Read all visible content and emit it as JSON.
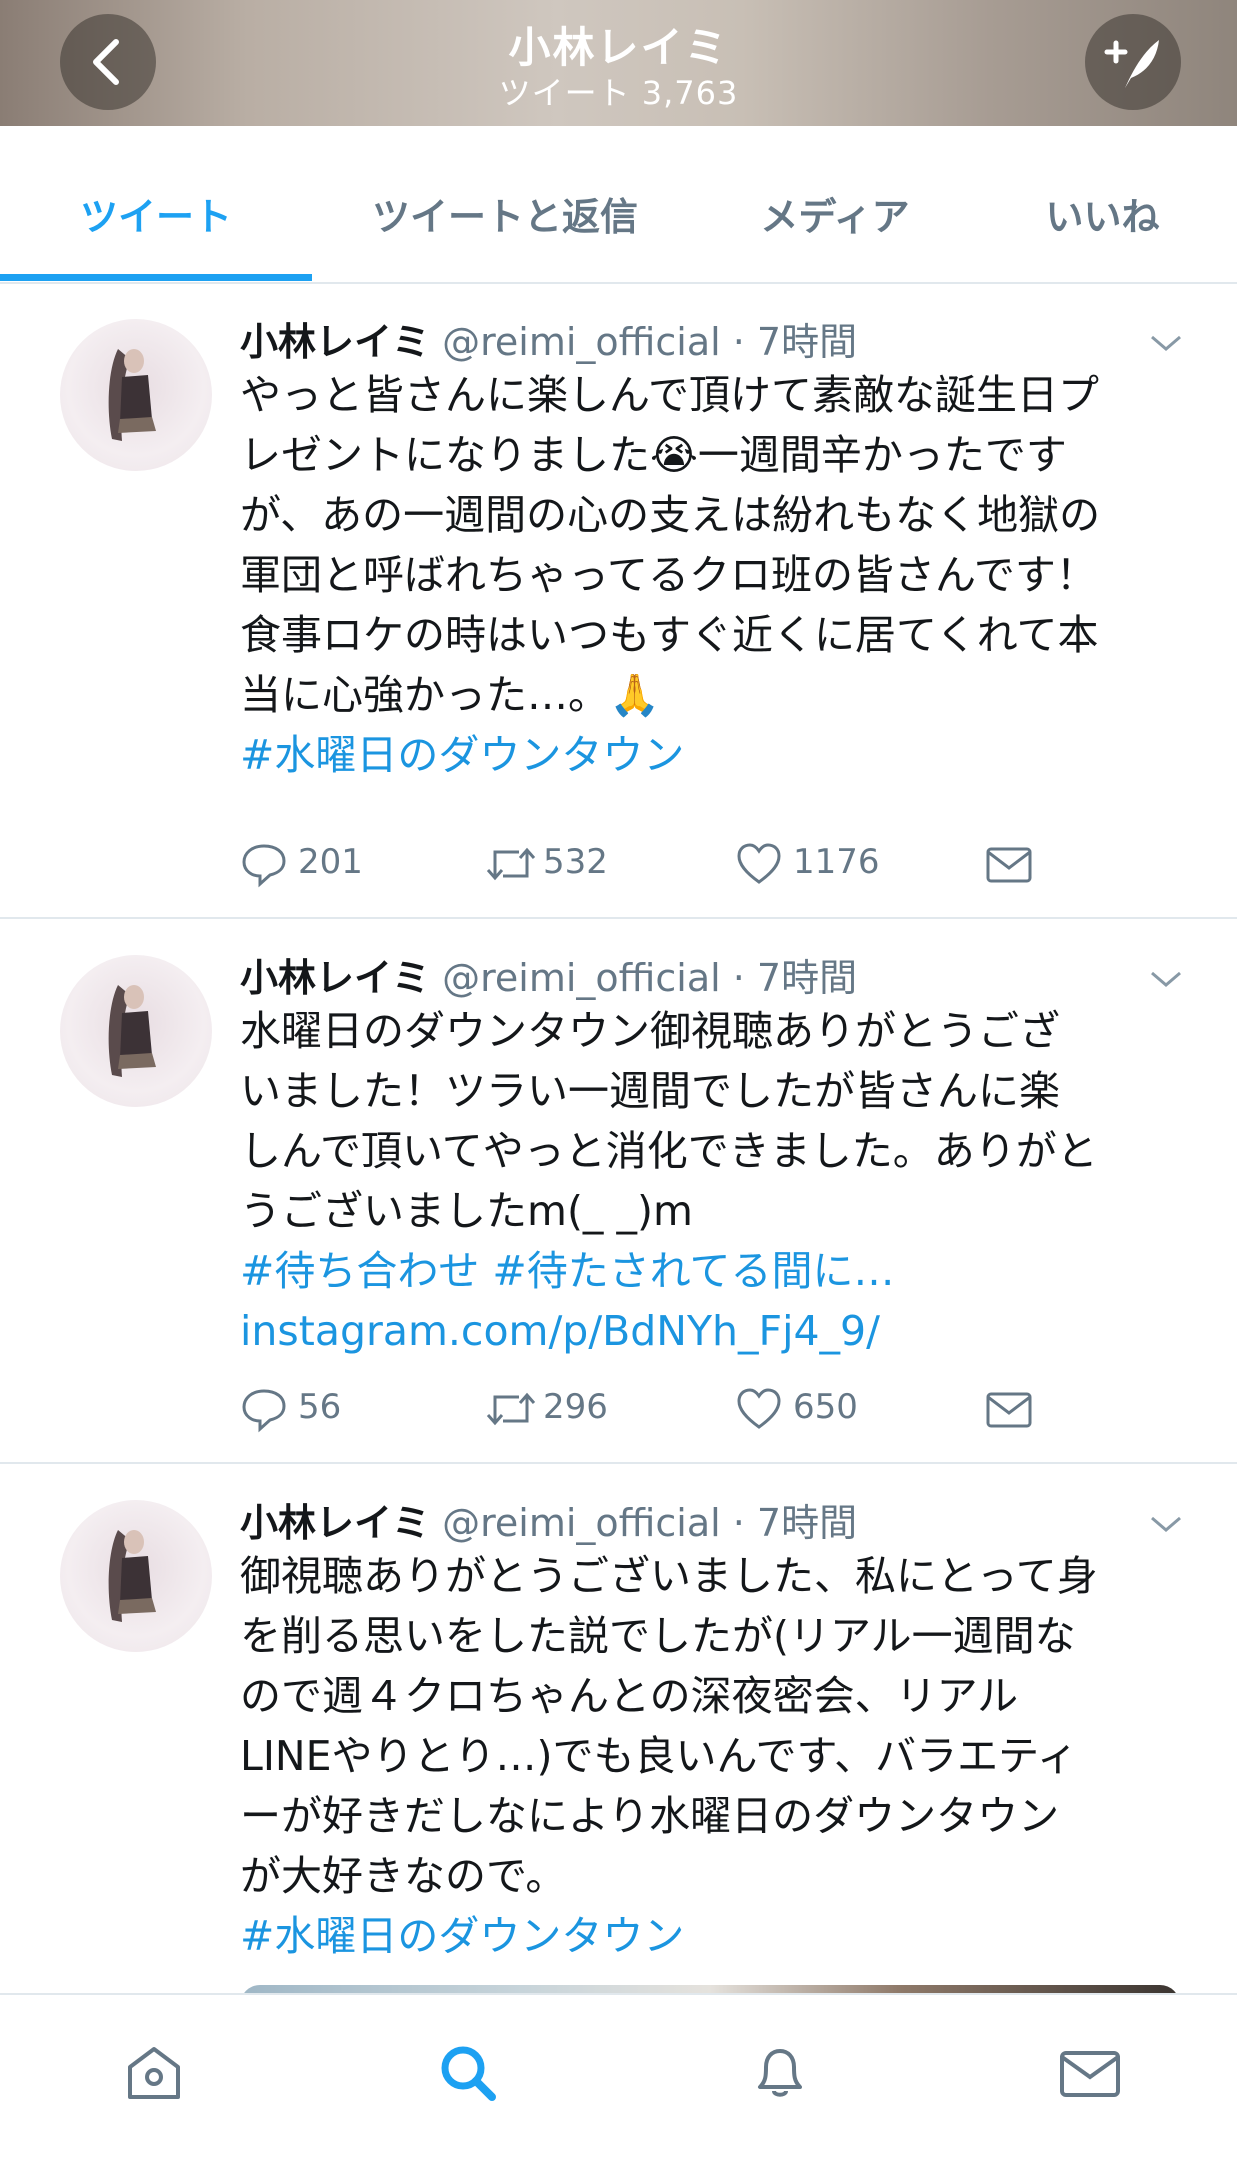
{
  "header": {
    "title": "小林レイミ",
    "tweet_count": "ツイート 3,763",
    "back_icon": "chevron-left-icon",
    "compose_icon": "compose-tweet-icon"
  },
  "tabs": [
    {
      "label": "ツイート",
      "active": true
    },
    {
      "label": "ツイートと返信",
      "active": false
    },
    {
      "label": "メディア",
      "active": false
    },
    {
      "label": "いいね",
      "active": false
    }
  ],
  "tweets": [
    {
      "name": "小林レイミ",
      "handle_time": "@reimi_official · 7時間",
      "lines": [
        "やっと皆さんに楽しんで頂けて素敵な誕生日プ",
        "レゼントになりました😭一週間辛かったです",
        "が、あの一週間の心の支えは紛れもなく地獄の",
        "軍団と呼ばれちゃってるクロ班の皆さんです！",
        "食事ロケの時はいつもすぐ近くに居てくれて本",
        "当に心強かった…。🙏"
      ],
      "links": [
        "#水曜日のダウンタウン"
      ],
      "replies": "201",
      "retweets": "532",
      "likes": "1176"
    },
    {
      "name": "小林レイミ",
      "handle_time": "@reimi_official · 7時間",
      "lines": [
        "水曜日のダウンタウン御視聴ありがとうござ",
        "いました！ツラい一週間でしたが皆さんに楽",
        "しんで頂いてやっと消化できました。ありがと",
        "うございましたm(_ _)m"
      ],
      "links": [
        "#待ち合わせ #待たされてる間に…",
        "instagram.com/p/BdNYh_Fj4_9/"
      ],
      "replies": "56",
      "retweets": "296",
      "likes": "650"
    },
    {
      "name": "小林レイミ",
      "handle_time": "@reimi_official · 7時間",
      "lines": [
        "御視聴ありがとうございました、私にとって身",
        "を削る思いをした説でしたが(リアル一週間な",
        "ので週４クロちゃんとの深夜密会、リアル",
        "LINEやりとり…)でも良いんです、バラエティ",
        "ーが好きだしなにより水曜日のダウンタウン",
        "が大好きなので。"
      ],
      "links": [
        "#水曜日のダウンタウン"
      ]
    }
  ],
  "bottom_nav": [
    {
      "icon": "home-icon"
    },
    {
      "icon": "search-icon",
      "active": true
    },
    {
      "icon": "notifications-bell-icon"
    },
    {
      "icon": "messages-envelope-icon"
    }
  ],
  "colors": {
    "accent": "#1da1f2",
    "link": "#1b95e0",
    "muted": "#657786",
    "divider": "#e1e8ed"
  }
}
